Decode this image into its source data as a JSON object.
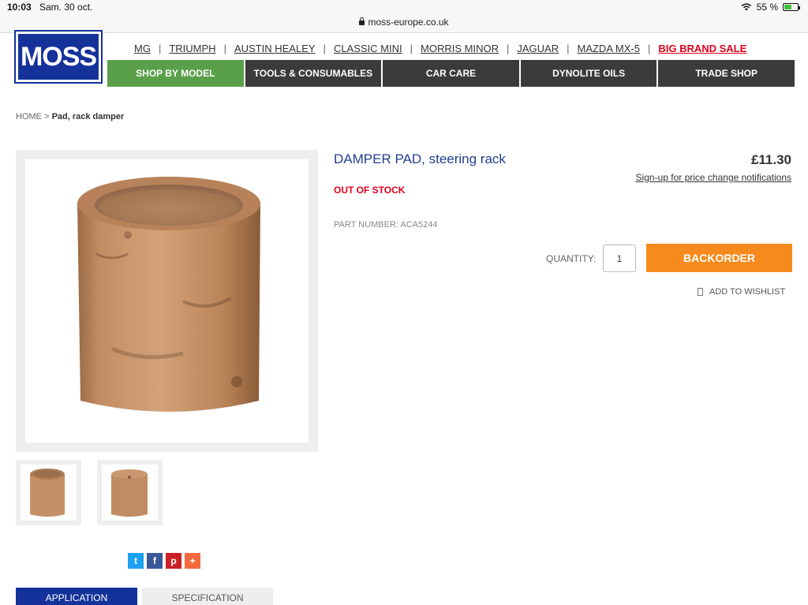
{
  "status_bar": {
    "time": "10:03",
    "date": "Sam. 30 oct.",
    "battery": "55 %",
    "battery_level": 0.55
  },
  "browser": {
    "url": "moss-europe.co.uk"
  },
  "logo": {
    "text": "MOSS"
  },
  "top_links": [
    {
      "label": "MG"
    },
    {
      "label": "TRIUMPH"
    },
    {
      "label": "AUSTIN HEALEY"
    },
    {
      "label": "CLASSIC MINI"
    },
    {
      "label": "MORRIS MINOR"
    },
    {
      "label": "JAGUAR"
    },
    {
      "label": "MAZDA MX-5"
    },
    {
      "label": "BIG BRAND SALE"
    }
  ],
  "main_nav": [
    {
      "label": "SHOP BY MODEL"
    },
    {
      "label": "TOOLS & CONSUMABLES"
    },
    {
      "label": "CAR CARE"
    },
    {
      "label": "DYNOLITE OILS"
    },
    {
      "label": "TRADE SHOP"
    }
  ],
  "breadcrumb": {
    "home": "HOME",
    "separator": ">",
    "current": "Pad, rack damper"
  },
  "product": {
    "title": "DAMPER PAD, steering rack",
    "price": "£11.30",
    "signup_link": "Sign-up for price change notifications",
    "stock_status": "OUT OF STOCK",
    "part_number": "PART NUMBER: ACA5244",
    "quantity_label": "QUANTITY:",
    "quantity_value": "1",
    "backorder_label": "BACKORDER",
    "wishlist_label": "ADD TO WISHLIST"
  },
  "social": {
    "twitter": "t",
    "facebook": "f",
    "pinterest": "p",
    "more": "+"
  },
  "tabs": [
    {
      "label": "APPLICATION"
    },
    {
      "label": "SPECIFICATION"
    }
  ],
  "colors": {
    "brand_blue": "#15329a",
    "nav_dark": "#3b3b3b",
    "nav_active_green": "#5aa04a",
    "sale_red": "#e0001a",
    "backorder_orange": "#f68a1c",
    "title_blue": "#1f3f8f"
  }
}
